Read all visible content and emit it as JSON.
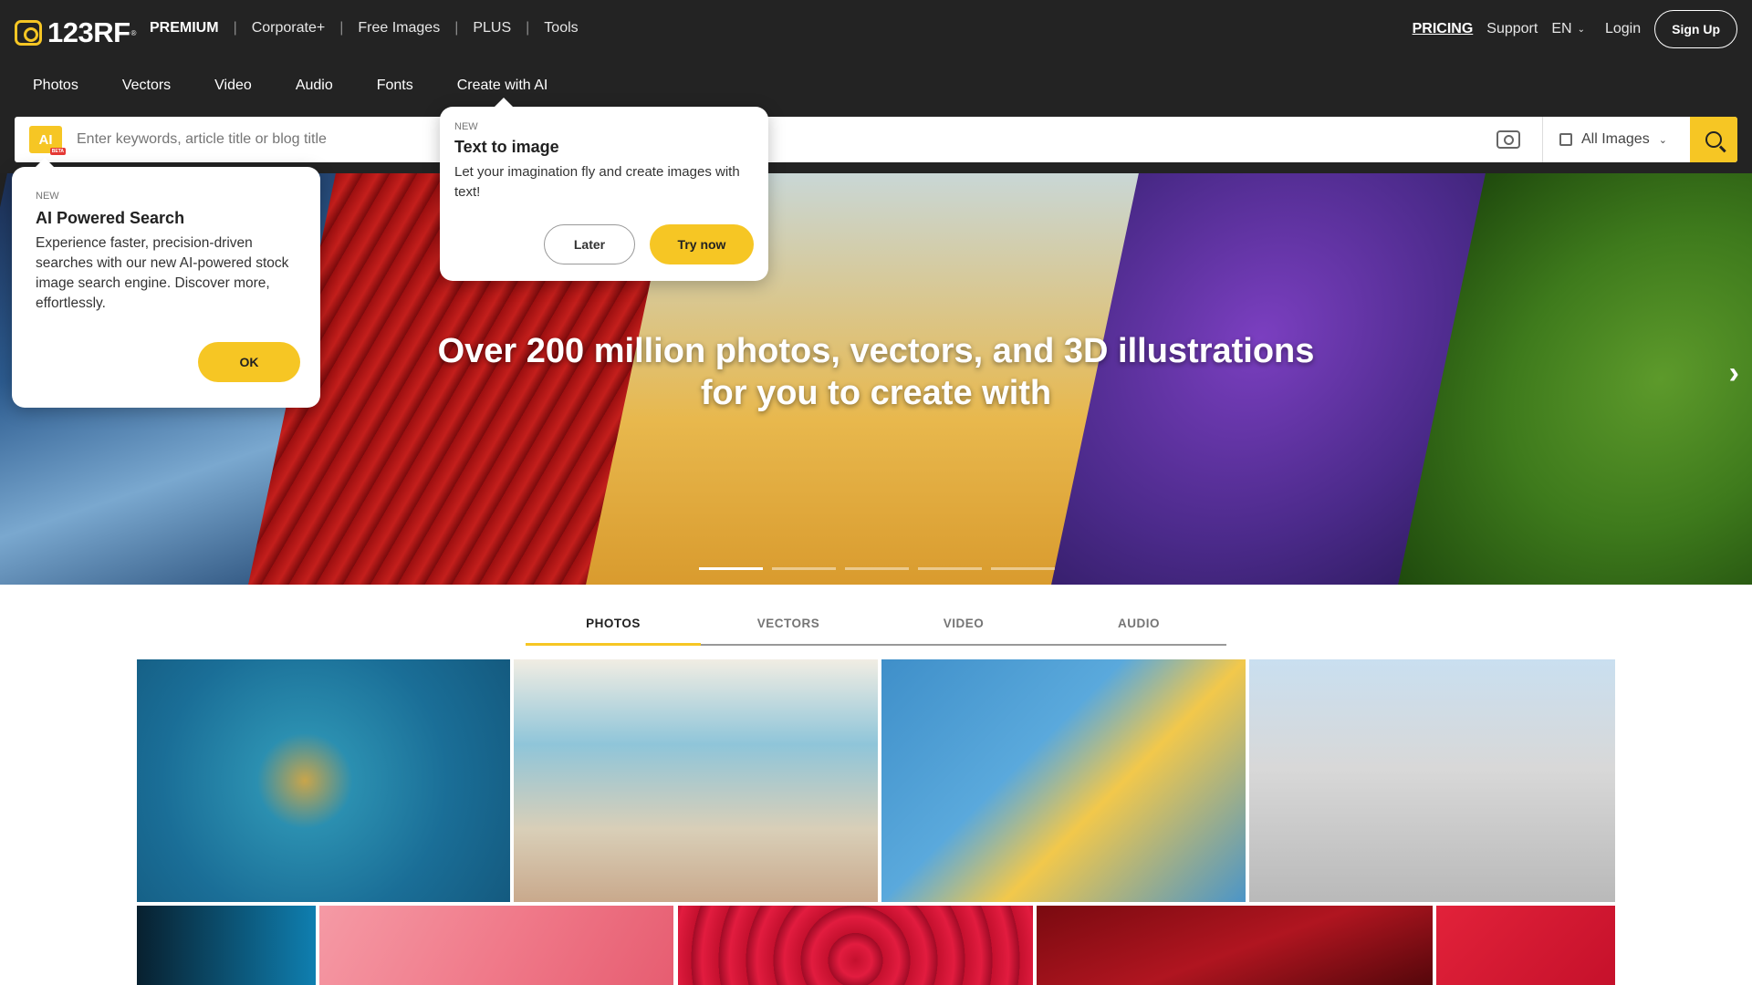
{
  "brand": {
    "name": "123RF",
    "reg": "®"
  },
  "topnav": {
    "items": [
      "PREMIUM",
      "Corporate+",
      "Free Images",
      "PLUS",
      "Tools"
    ],
    "separator": "|"
  },
  "right_nav": {
    "pricing": "PRICING",
    "support": "Support",
    "language": "EN",
    "login": "Login",
    "signup": "Sign Up"
  },
  "categories": [
    "Photos",
    "Vectors",
    "Video",
    "Audio",
    "Fonts",
    "Create with AI"
  ],
  "search": {
    "ai_badge": "AI",
    "beta": "BETA",
    "placeholder": "Enter keywords, article title or blog title",
    "type_selected": "All Images"
  },
  "hero": {
    "title": "Over 200 million photos, vectors, and 3D illustrations for you to create with",
    "slides_count": 5,
    "active_slide": 1
  },
  "popover_ai": {
    "tag": "NEW",
    "title": "AI Powered Search",
    "body": "Experience faster, precision-driven searches with our new AI-powered stock image search engine. Discover more, effortlessly.",
    "ok": "OK"
  },
  "popover_tti": {
    "tag": "NEW",
    "title": "Text to image",
    "body": "Let your imagination fly and create images with text!",
    "later": "Later",
    "try": "Try now"
  },
  "tabs": [
    "PHOTOS",
    "VECTORS",
    "VIDEO",
    "AUDIO"
  ],
  "active_tab": "PHOTOS",
  "colors": {
    "accent": "#f6c624",
    "header_bg": "#232323"
  }
}
